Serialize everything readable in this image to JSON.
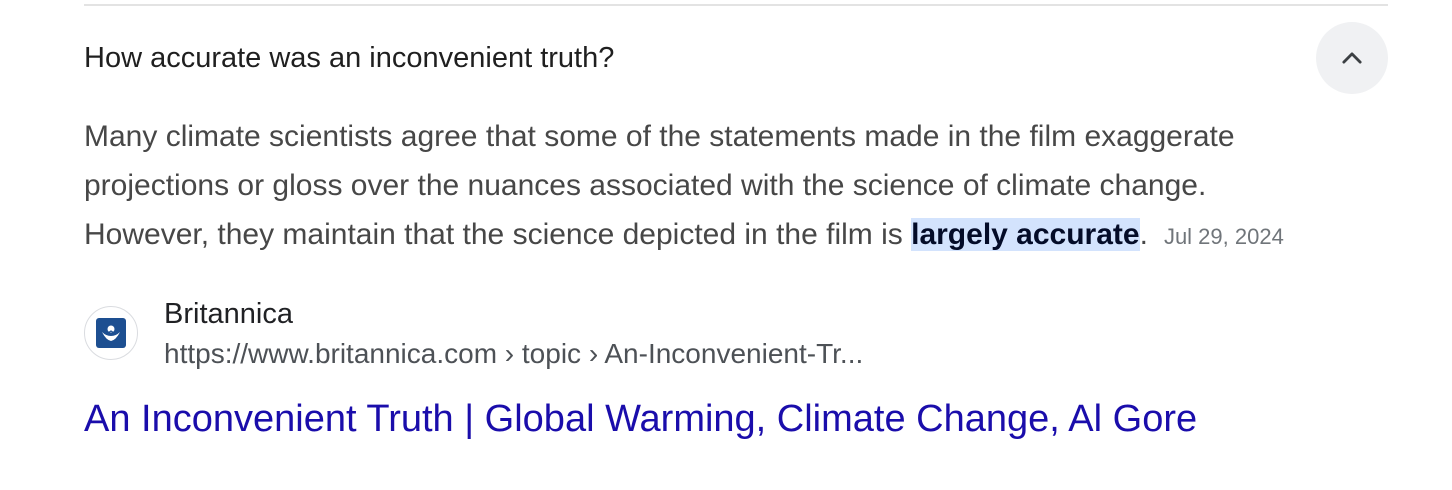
{
  "question": {
    "text": "How accurate was an inconvenient truth?"
  },
  "answer": {
    "line1": "Many climate scientists agree that some of the statements made in the film exaggerate",
    "line2": "projections or gloss over the nuances associated with the science of climate change.",
    "line3_before": "However, they maintain that the science depicted in the film is ",
    "highlight": "largely accurate",
    "line3_after": ".",
    "date": "Jul 29, 2024"
  },
  "source": {
    "name": "Britannica",
    "url": "https://www.britannica.com › topic › An-Inconvenient-Tr...",
    "icon": "britannica-logo-icon"
  },
  "result": {
    "title": "An Inconvenient Truth | Global Warming, Climate Change, Al Gore"
  },
  "colors": {
    "link": "#1a0dab",
    "highlight_bg": "#d3e3fd",
    "logo_blue": "#1d4f91"
  }
}
